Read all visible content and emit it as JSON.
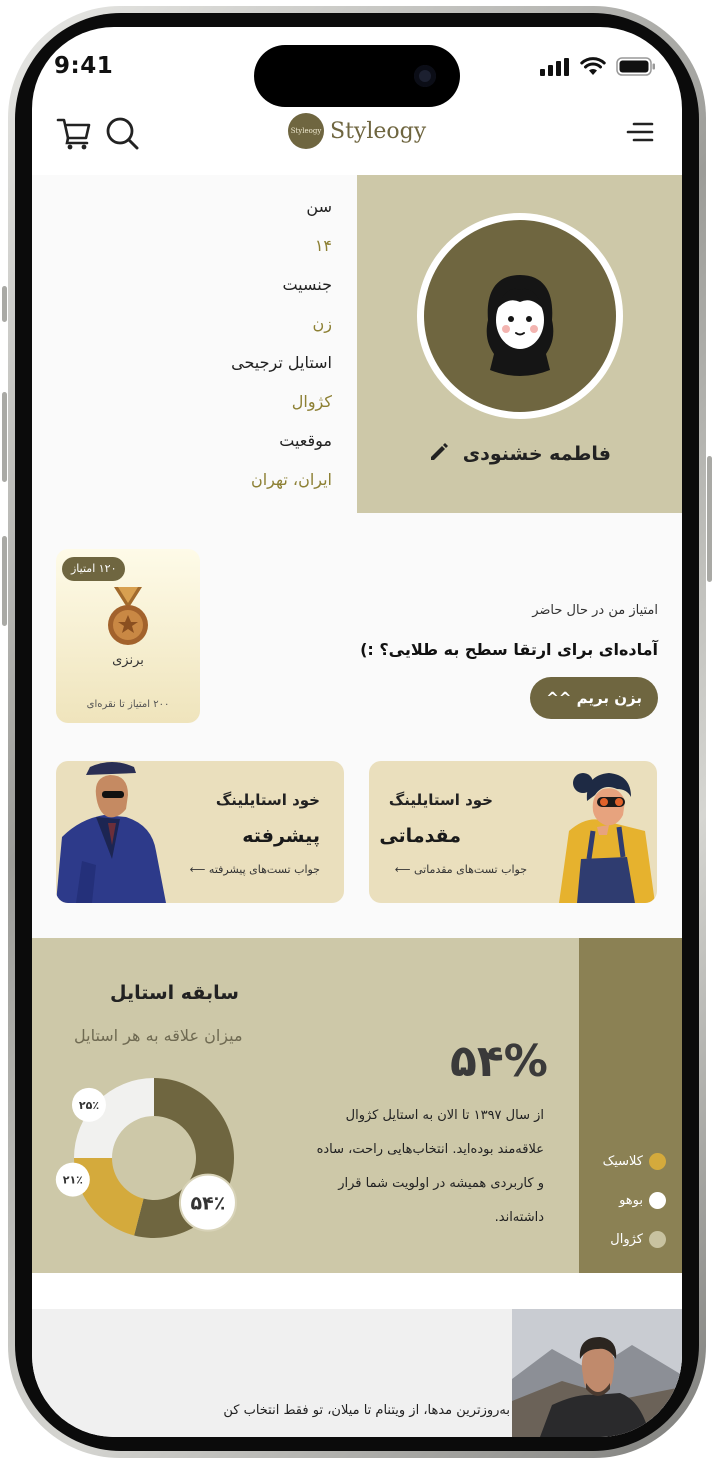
{
  "status_bar": {
    "time": "9:41"
  },
  "header": {
    "brand": "Styleogy",
    "logo_mark": "Styleogy"
  },
  "profile": {
    "name": "فاطمه خشنودی",
    "fields": [
      {
        "label": "سن",
        "value": "۱۴"
      },
      {
        "label": "جنسیت",
        "value": "زن"
      },
      {
        "label": "استایل ترجیحی",
        "value": "کژوال"
      },
      {
        "label": "موقعیت",
        "value": "ایران، تهران"
      }
    ]
  },
  "score": {
    "caption": "امتیاز من در حال حاضر",
    "headline": "آماده‌ای برای ارتقا سطح به طلایی؟ :)",
    "button": "بزن بریم ^^",
    "badge": {
      "points": "۱۲۰ امتیاز",
      "level": "برنزی",
      "next": "۲۰۰ امتیاز تا نقره‌ای"
    }
  },
  "cards": [
    {
      "title": "خود استایلینگ",
      "level": "مقدماتی",
      "link": "جواب تست‌های مقدماتی"
    },
    {
      "title": "خود استایلینگ",
      "level": "پیشرفته",
      "link": "جواب تست‌های پیشرفته"
    }
  ],
  "history": {
    "title": "سابقه استایل",
    "subtitle": "میزان علاقه به هر استایل",
    "percent": "۵۴%",
    "description": "از سال ۱۳۹۷ تا الان به استایل کژوال علاقه‌مند بوده‌اید. انتخاب‌هایی راحت، ساده و کاربردی همیشه در اولویت شما قرار داشته‌اند.",
    "legend": [
      {
        "label": "کلاسیک",
        "color": "#d4aa3c"
      },
      {
        "label": "بوهو",
        "color": "#ffffff"
      },
      {
        "label": "کژوال",
        "color": "#c8c2a0"
      }
    ]
  },
  "chart_data": {
    "type": "pie",
    "series": [
      {
        "name": "کژوال",
        "value": 54,
        "label": "۵۴٪",
        "color": "#6f6640"
      },
      {
        "name": "کلاسیک",
        "value": 21,
        "label": "۲۱٪",
        "color": "#d4aa3c"
      },
      {
        "name": "بوهو",
        "value": 25,
        "label": "۲۵٪",
        "color": "#f1f1ef"
      }
    ]
  },
  "promo": {
    "text": "به‌روزترین مدها، از ویتنام تا میلان، تو فقط انتخاب کن"
  }
}
